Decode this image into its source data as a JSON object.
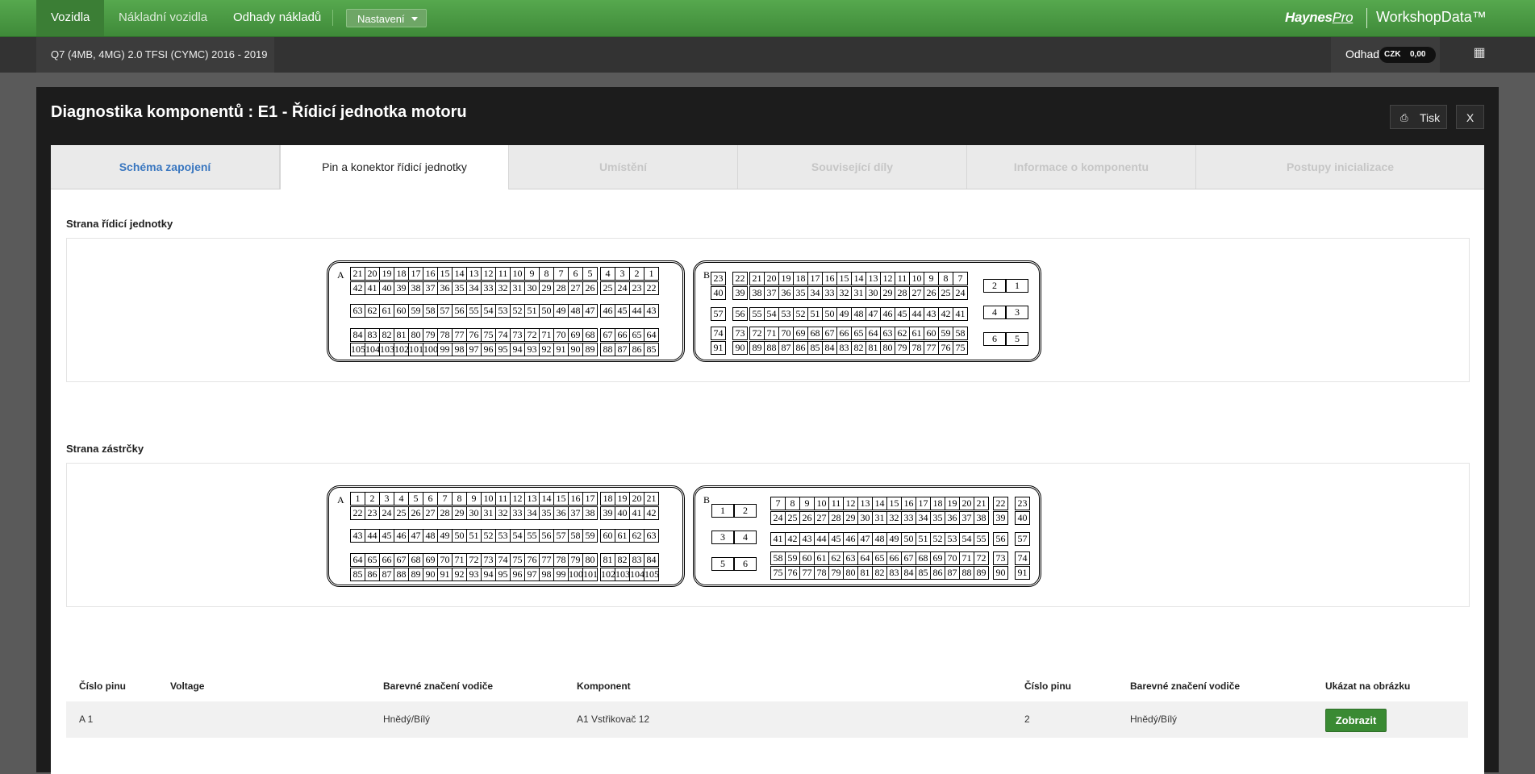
{
  "nav": {
    "items": [
      "Vozidla",
      "Nákladní vozidla",
      "Odhady nákladů"
    ],
    "settings_label": "Nastavení",
    "brand_bold": "Haynes",
    "brand_pro": "Pro",
    "brand_product": "WorkshopData™"
  },
  "vehicle": {
    "label": "Q7 (4MB, 4MG) 2.0 TFSI (CYMC) 2016 - 2019"
  },
  "estimate": {
    "label": "Odhad",
    "currency": "CZK",
    "value": "0,00"
  },
  "modal": {
    "title": "Diagnostika komponentů : E1 - Řídicí jednotka motoru",
    "print_label": "Tisk",
    "close_label": "X"
  },
  "tabs": [
    "Schéma zapojení",
    "Pin a konektor řídicí jednotky",
    "Umístění",
    "Související díly",
    "Informace o komponentu",
    "Postupy inicializace"
  ],
  "sections": {
    "ecu_side": "Strana řídicí jednotky",
    "plug_side": "Strana zástrčky"
  },
  "connectors": {
    "a_letter": "A",
    "b_letter": "B"
  },
  "table": {
    "headers": [
      "Číslo pinu",
      "Voltage",
      "Barevné značení vodiče",
      "Komponent",
      "Číslo pinu",
      "Barevné značení vodiče",
      "Ukázat na obrázku"
    ],
    "rows": [
      {
        "pin": "A 1",
        "voltage": "",
        "color": "Hnědý/Bílý",
        "component": "A1 Vstřikovač 12",
        "comp_pin": "2",
        "comp_color": "Hnědý/Bílý",
        "action": "Zobrazit"
      }
    ]
  },
  "colors": {
    "accent": "#4a9c42",
    "button": "#3a8a33",
    "link": "#3a77c0"
  }
}
